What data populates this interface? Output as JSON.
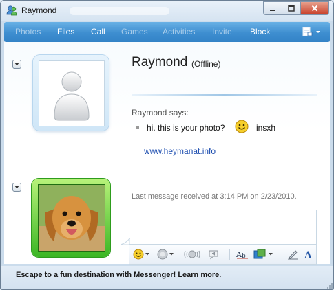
{
  "window": {
    "title": "Raymond"
  },
  "toolbar": {
    "items": [
      {
        "label": "Photos",
        "enabled": false
      },
      {
        "label": "Files",
        "enabled": true
      },
      {
        "label": "Call",
        "enabled": true
      },
      {
        "label": "Games",
        "enabled": false
      },
      {
        "label": "Activities",
        "enabled": false
      },
      {
        "label": "Invite",
        "enabled": false
      },
      {
        "label": "Block",
        "enabled": true
      }
    ]
  },
  "contact": {
    "name": "Raymond",
    "status": "(Offline)"
  },
  "conversation": {
    "sender_line": "Raymond says:",
    "message_text": "hi. this is your photo?",
    "message_tail": "insxh",
    "link": "www.heymanat.info",
    "last_message": "Last message received at 3:14 PM on 2/23/2010."
  },
  "footer": {
    "text": "Escape to a fun destination with Messenger! Learn more."
  },
  "colors": {
    "toolbar_active": "#ffffff",
    "toolbar_disabled": "#a9cdeb",
    "link": "#1f4fb0",
    "me_frame": "#3bb624"
  },
  "icons": {
    "app": "messenger-buddy-icon",
    "toolbar_menu": "show-menu-icon",
    "emoticon": "smile-emoticon-icon"
  }
}
